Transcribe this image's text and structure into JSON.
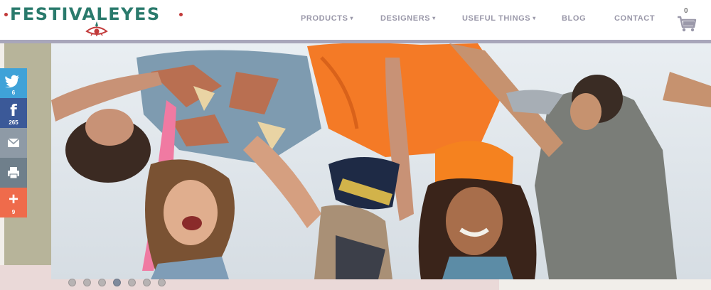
{
  "brand": {
    "name": "FESTIVALEYES",
    "colors": {
      "logo_text": "#2a7a6c",
      "logo_accent": "#c23a3a",
      "nav_text": "#9a98a9",
      "header_rule": "#a8a6ba"
    }
  },
  "nav": {
    "items": [
      {
        "label": "PRODUCTS",
        "dropdown": true
      },
      {
        "label": "DESIGNERS",
        "dropdown": true
      },
      {
        "label": "USEFUL THINGS",
        "dropdown": true
      },
      {
        "label": "BLOG",
        "dropdown": false
      },
      {
        "label": "CONTACT",
        "dropdown": false
      }
    ],
    "caret": "▾"
  },
  "cart": {
    "count": "0",
    "icon": "cart-icon"
  },
  "share": {
    "twitter": {
      "icon": "twitter-icon",
      "count": "6"
    },
    "facebook": {
      "icon": "facebook-icon",
      "glyph": "f",
      "count": "265"
    },
    "email": {
      "icon": "email-icon"
    },
    "print": {
      "icon": "print-icon"
    },
    "more": {
      "icon": "plus-icon",
      "glyph": "+",
      "count": "9"
    }
  },
  "hero": {
    "image_subject": "festival-crowd-photo",
    "slides": {
      "total": 7,
      "active_index": 3
    }
  }
}
